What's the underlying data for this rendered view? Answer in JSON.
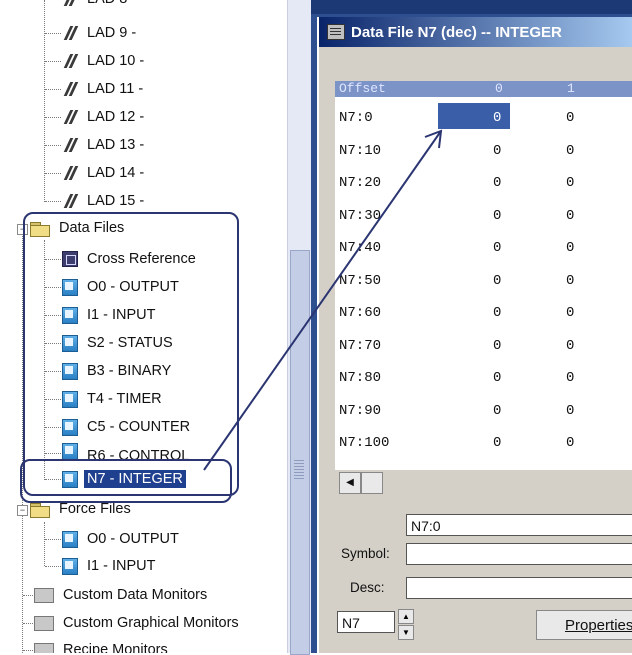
{
  "tree": {
    "lad_items": [
      "LAD 9 -",
      "LAD 10 -",
      "LAD 11 -",
      "LAD 12 -",
      "LAD 13 -",
      "LAD 14 -",
      "LAD 15 -"
    ],
    "data_files_label": "Data Files",
    "data_files": [
      "Cross Reference",
      "O0 - OUTPUT",
      "I1 - INPUT",
      "S2 - STATUS",
      "B3 - BINARY",
      "T4 - TIMER",
      "C5 - COUNTER",
      "R6 - CONTROL",
      "N7 - INTEGER"
    ],
    "force_files_label": "Force Files",
    "force_files": [
      "O0 - OUTPUT",
      "I1 - INPUT"
    ],
    "other_folders": [
      "Custom Data Monitors",
      "Custom Graphical Monitors",
      "Recipe Monitors"
    ],
    "selected": "N7 - INTEGER"
  },
  "window": {
    "title": "Data File N7 (dec)  --  INTEGER",
    "grid": {
      "headers": [
        "Offset",
        "0",
        "1"
      ],
      "rows": [
        {
          "offset": "N7:0",
          "v0": "0",
          "v1": "0"
        },
        {
          "offset": "N7:10",
          "v0": "0",
          "v1": "0"
        },
        {
          "offset": "N7:20",
          "v0": "0",
          "v1": "0"
        },
        {
          "offset": "N7:30",
          "v0": "0",
          "v1": "0"
        },
        {
          "offset": "N7:40",
          "v0": "0",
          "v1": "0"
        },
        {
          "offset": "N7:50",
          "v0": "0",
          "v1": "0"
        },
        {
          "offset": "N7:60",
          "v0": "0",
          "v1": "0"
        },
        {
          "offset": "N7:70",
          "v0": "0",
          "v1": "0"
        },
        {
          "offset": "N7:80",
          "v0": "0",
          "v1": "0"
        },
        {
          "offset": "N7:90",
          "v0": "0",
          "v1": "0"
        },
        {
          "offset": "N7:100",
          "v0": "0",
          "v1": "0"
        }
      ]
    },
    "address_value": "N7:0",
    "symbol_label": "Symbol:",
    "symbol_value": "",
    "desc_label": "Desc:",
    "desc_value": "",
    "file_value": "N7",
    "properties_label": "Properties"
  },
  "colors": {
    "title_start": "#0a246a",
    "selection": "#1f3f8f",
    "annotation": "#2b3572"
  }
}
